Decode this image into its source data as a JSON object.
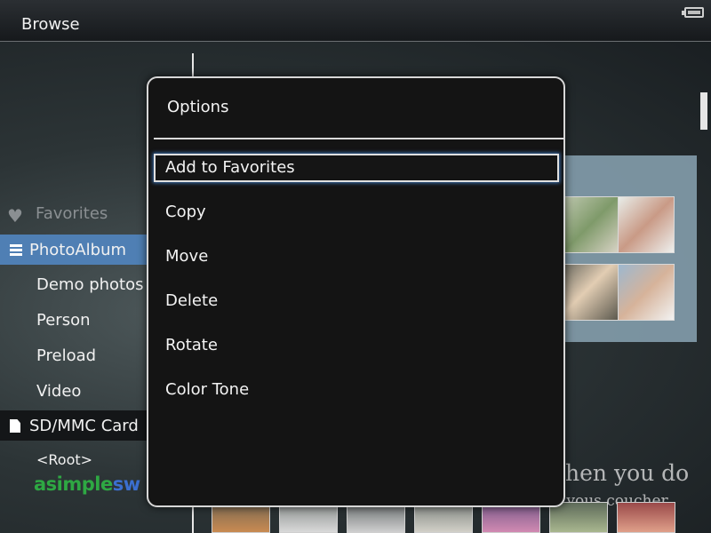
{
  "header": {
    "title": "Browse"
  },
  "nav": {
    "favorites": "Favorites",
    "photoalbum": "PhotoAlbum",
    "items": [
      "Demo photos",
      "Person",
      "Preload",
      "Video"
    ],
    "sdcard": "SD/MMC Card",
    "root": "<Root>"
  },
  "logo": {
    "part1": "asimple",
    "part2": "sw"
  },
  "background_text": {
    "line1": "hen you do",
    "line2": "z vous coucher"
  },
  "dialog": {
    "title": "Options",
    "options": [
      "Add to Favorites",
      "Copy",
      "Move",
      "Delete",
      "Rotate",
      "Color Tone"
    ]
  },
  "colors": {
    "accent": "#4f7fb4",
    "selection_glow": "#3a6fb0"
  }
}
